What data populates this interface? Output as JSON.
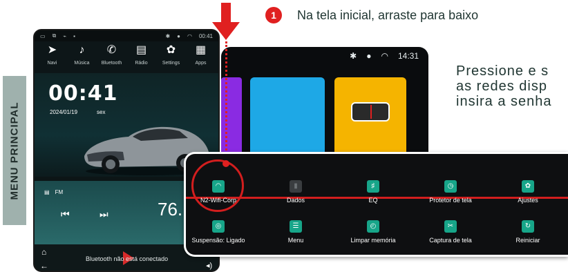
{
  "side_label": "MENU PRINCIPAL",
  "step": {
    "number": "1",
    "text": "Na tela inicial, arraste para baixo"
  },
  "instruction": "Pressione e s\nas redes disp\ninsira a senha",
  "colors": {
    "accent": "#e02020",
    "tile_on": "#17a589",
    "panel_bg": "#0e0f11"
  },
  "phone": {
    "status_icons": [
      "window-icon",
      "copy-icon",
      "usb-icon",
      "dot-icon"
    ],
    "status_right": [
      "bluetooth-icon",
      "location-icon",
      "wifi-icon"
    ],
    "status_time": "00:41",
    "apps": [
      {
        "icon": "navigation-icon",
        "label": "Navi"
      },
      {
        "icon": "music-icon",
        "label": "Música"
      },
      {
        "icon": "phone-icon",
        "label": "Bluetooth"
      },
      {
        "icon": "radio-icon",
        "label": "Rádio"
      },
      {
        "icon": "gear-icon",
        "label": "Settings"
      },
      {
        "icon": "apps-icon",
        "label": "Apps"
      }
    ],
    "time": "00:41",
    "date": "2024/01/19",
    "day": "sex",
    "band": "FM",
    "frequency": "76.",
    "bt_status": "Bluetooth não está conectado"
  },
  "landscape": {
    "time": "14:31"
  },
  "quick_settings": {
    "row1": [
      {
        "icon": "wifi-icon",
        "label": "N2-Wifi-Corp",
        "on": true
      },
      {
        "icon": "signal-icon",
        "label": "Dados",
        "on": false
      },
      {
        "icon": "equalizer-icon",
        "label": "EQ",
        "on": true
      },
      {
        "icon": "timer-icon",
        "label": "Protetor de tela",
        "on": true
      },
      {
        "icon": "settings-icon",
        "label": "Ajustes",
        "on": true
      }
    ],
    "row2": [
      {
        "icon": "suspend-icon",
        "label": "Suspensão: Ligado",
        "on": true
      },
      {
        "icon": "menu-icon",
        "label": "Menu",
        "on": true
      },
      {
        "icon": "clean-memory-icon",
        "label": "Limpar memória",
        "on": true
      },
      {
        "icon": "screenshot-icon",
        "label": "Captura de tela",
        "on": true
      },
      {
        "icon": "restart-icon",
        "label": "Reiniciar",
        "on": true
      }
    ]
  }
}
